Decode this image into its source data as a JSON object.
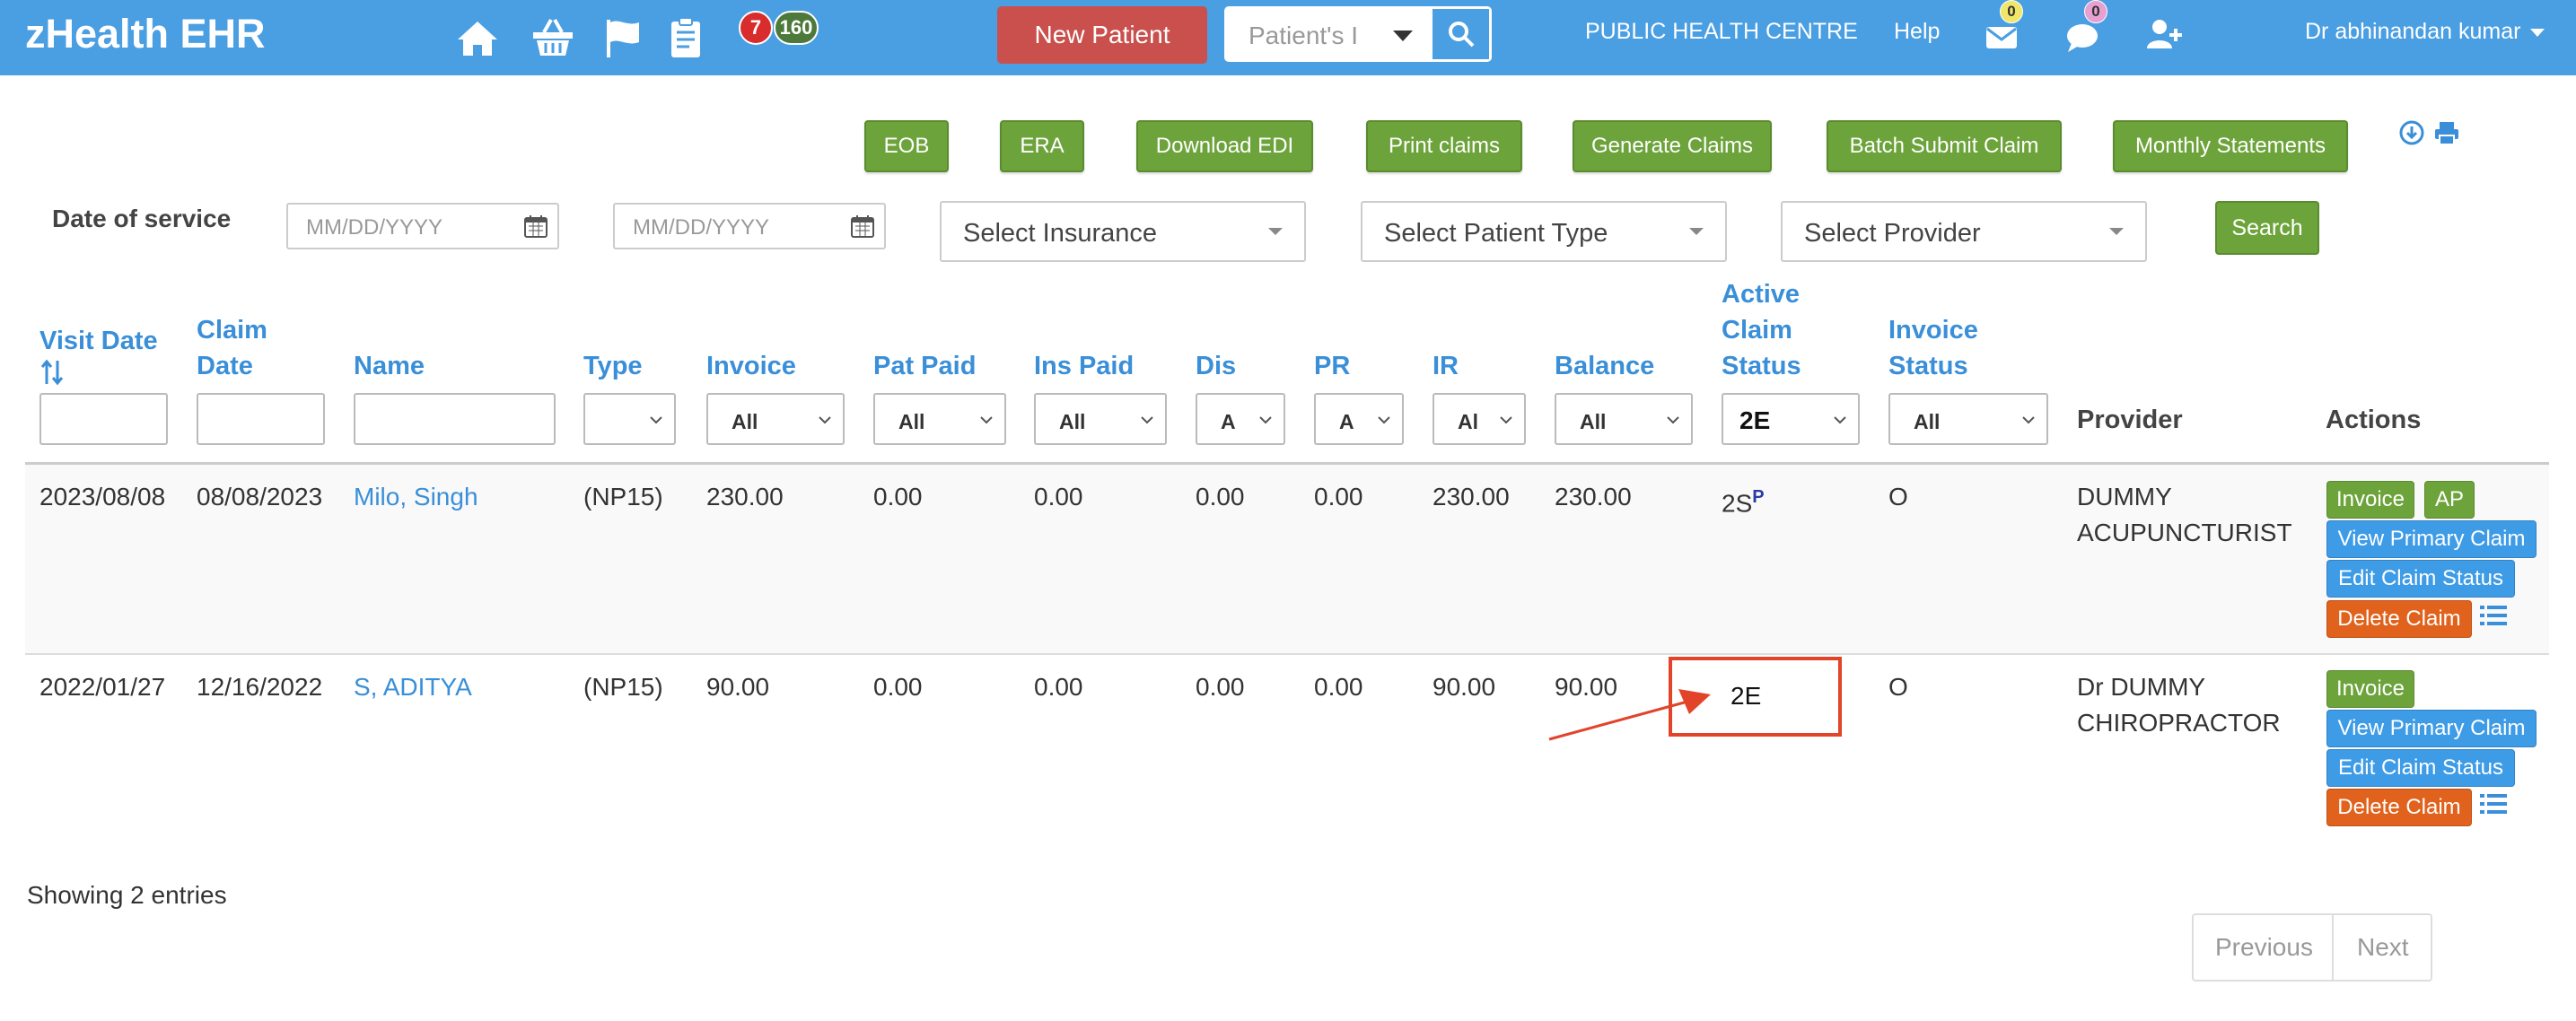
{
  "app": {
    "brand": "zHealth EHR"
  },
  "navbar": {
    "icons": [
      "home-icon",
      "basket-icon",
      "flag-icon",
      "clipboard-icon"
    ],
    "badge_red": "7",
    "badge_green": "160",
    "new_patient_label": "New Patient",
    "patient_search_placeholder": "Patient's I",
    "location": "PUBLIC HEALTH CENTRE",
    "help": "Help",
    "mail_count": "0",
    "chat_count": "0",
    "user": "Dr abhinandan kumar"
  },
  "toolbar": {
    "eob": "EOB",
    "era": "ERA",
    "download_edi": "Download EDI",
    "print_claims": "Print claims",
    "generate_claims": "Generate Claims",
    "batch_submit": "Batch Submit Claim",
    "monthly_statements": "Monthly Statements"
  },
  "filters": {
    "date_of_service_label": "Date of service",
    "date_from_placeholder": "MM/DD/YYYY",
    "date_to_placeholder": "MM/DD/YYYY",
    "insurance": "Select Insurance",
    "patient_type": "Select Patient Type",
    "provider": "Select Provider",
    "search": "Search"
  },
  "table": {
    "headers": {
      "visit_date": "Visit Date",
      "claim_date_1": "Claim",
      "claim_date_2": "Date",
      "name": "Name",
      "type": "Type",
      "invoice": "Invoice",
      "pat_paid": "Pat Paid",
      "ins_paid": "Ins Paid",
      "dis": "Dis",
      "pr": "PR",
      "ir": "IR",
      "balance": "Balance",
      "acs_1": "Active",
      "acs_2": "Claim",
      "acs_3": "Status",
      "inv_status_1": "Invoice",
      "inv_status_2": "Status",
      "provider": "Provider",
      "actions": "Actions"
    },
    "filter_values": {
      "invoice": "All",
      "pat_paid": "All",
      "ins_paid": "All",
      "dis": "A",
      "pr": "A",
      "ir": "Al",
      "balance": "All",
      "acs": "2E",
      "inv_status": "All"
    },
    "rows": [
      {
        "visit_date": "2023/08/08",
        "claim_date": "08/08/2023",
        "name": "Milo, Singh",
        "type": "(NP15)",
        "invoice": "230.00",
        "pat_paid": "0.00",
        "ins_paid": "0.00",
        "dis": "0.00",
        "pr": "0.00",
        "ir": "230.00",
        "balance": "230.00",
        "claim_status": "2S",
        "claim_status_sup": "P",
        "invoice_status": "O",
        "provider_1": "DUMMY",
        "provider_2": "ACUPUNCTURIST",
        "btn_invoice": "Invoice",
        "btn_ap": "AP",
        "btn_view": "View Primary Claim",
        "btn_edit": "Edit Claim Status",
        "btn_delete": "Delete Claim"
      },
      {
        "visit_date": "2022/01/27",
        "claim_date": "12/16/2022",
        "name": "S, ADITYA",
        "type": "(NP15)",
        "invoice": "90.00",
        "pat_paid": "0.00",
        "ins_paid": "0.00",
        "dis": "0.00",
        "pr": "0.00",
        "ir": "90.00",
        "balance": "90.00",
        "claim_status": "2E",
        "invoice_status": "O",
        "provider_1": "Dr DUMMY",
        "provider_2": "CHIROPRACTOR",
        "btn_invoice": "Invoice",
        "btn_view": "View Primary Claim",
        "btn_edit": "Edit Claim Status",
        "btn_delete": "Delete Claim"
      }
    ]
  },
  "footer": {
    "showing": "Showing 2 entries",
    "previous": "Previous",
    "next": "Next"
  },
  "colors": {
    "navbar": "#4a9ee2",
    "green_button": "#6da33b",
    "new_patient": "#c9504d",
    "blue_button": "#3e9be6",
    "delete_button": "#e0621c",
    "annotation": "#e2442a"
  }
}
